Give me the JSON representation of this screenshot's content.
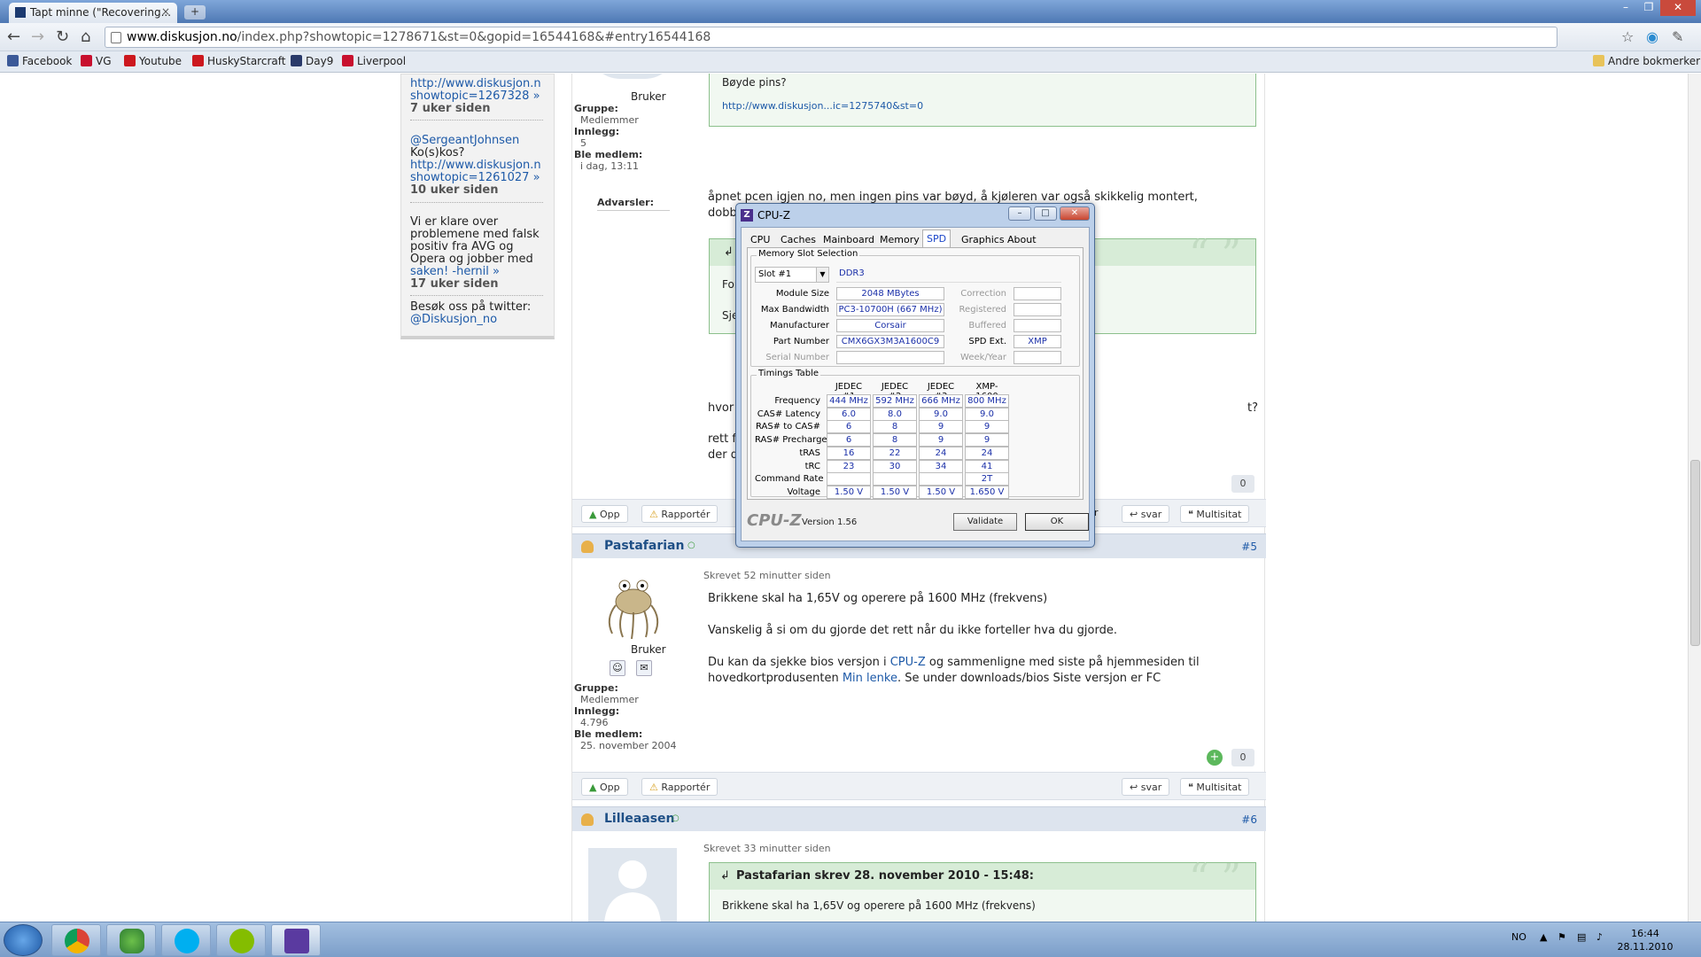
{
  "browser": {
    "tab_title": "Tapt minne (\"Recovering...",
    "tab_close": "×",
    "new_tab": "+",
    "url_host": "www.diskusjon.no",
    "url_path": "/index.php?showtopic=1278671&st=0&gopid=16544168&#entry16544168",
    "other_bookmarks": "Andre bokmerker",
    "bookmarks": [
      "Facebook",
      "VG",
      "Youtube",
      "HuskyStarcraft",
      "Day9",
      "Liverpool"
    ]
  },
  "sidebar": {
    "entry1_link1": "http://www.diskusjon.n",
    "entry1_link2": "showtopic=1267328 »",
    "entry1_time": "7 uker siden",
    "entry2_user": "@SergeantJohnsen",
    "entry2_text": "Ko(s)kos?",
    "entry2_link1": "http://www.diskusjon.n",
    "entry2_link2": "showtopic=1261027 »",
    "entry2_time": "10 uker siden",
    "entry3_l1": "Vi er klare over",
    "entry3_l2": "problemene med falsk",
    "entry3_l3": "positiv fra AVG og",
    "entry3_l4": "Opera og jobber med",
    "entry3_l5": "saken! -hernil »",
    "entry3_time": "17 uker siden",
    "twitter_l1": "Besøk oss på twitter:",
    "twitter_l2": "@Diskusjon_no"
  },
  "post4": {
    "role": "Bruker",
    "group_label": "Gruppe:",
    "group": "Medlemmer",
    "posts_label": "Innlegg:",
    "posts": "5",
    "member_label": "Ble medlem:",
    "member": "i dag, 13:11",
    "warn_label": "Advarsler:",
    "quote_top": "Bøyde pins?",
    "quote_link": "http://www.diskusjon...ic=1275740&st=0",
    "line1": "åpnet pcen igjen no, men ingen pins var bøyd, å kjøleren var også skikkelig montert,",
    "line2": "dobb",
    "q2_a": "For",
    "q2_b": "Sje",
    "line3": "hvor",
    "line3_end": "t?",
    "line4": "rett f",
    "line5": "der d",
    "votes": "0",
    "btn_top": "Opp",
    "btn_report": "Rapportér",
    "btn_r": "r",
    "btn_reply": "svar",
    "btn_multi": "Multisitat"
  },
  "post5": {
    "author": "Pastafarian",
    "number": "#5",
    "written": "Skrevet 52 minutter siden",
    "text1": "Brikkene skal ha 1,65V og operere på 1600 MHz (frekvens)",
    "text2": "Vanskelig å si om du gjorde det rett når du ikke forteller hva du gjorde.",
    "text3a": "Du kan da sjekke bios versjon i ",
    "text3_link": "CPU-Z",
    "text3b": " og sammenligne med siste på hjemmesiden til",
    "text4a": "hovedkortprodusenten ",
    "text4_link": "Min lenke",
    "text4b": ". Se under downloads/bios Siste versjon er FC",
    "role": "Bruker",
    "group_label": "Gruppe:",
    "group": "Medlemmer",
    "posts_label": "Innlegg:",
    "posts": "4.796",
    "member_label": "Ble medlem:",
    "member": "25. november 2004",
    "votes": "0",
    "btn_top": "Opp",
    "btn_report": "Rapportér",
    "btn_reply": "svar",
    "btn_multi": "Multisitat"
  },
  "post6": {
    "author": "Lilleaasen",
    "number": "#6",
    "written": "Skrevet 33 minutter siden",
    "quote_head": "Pastafarian skrev 28. november 2010 - 15:48:",
    "quote_text": "Brikkene skal ha 1,65V og operere på 1600 MHz (frekvens)"
  },
  "cpuz": {
    "title": "CPU-Z",
    "logo": "Z",
    "tabs": [
      "CPU",
      "Caches",
      "Mainboard",
      "Memory",
      "SPD",
      "Graphics",
      "About"
    ],
    "slot_group": "Memory Slot Selection",
    "slot": "Slot #1",
    "mem_type": "DDR3",
    "labels": {
      "module_size": "Module Size",
      "max_bandwidth": "Max Bandwidth",
      "manufacturer": "Manufacturer",
      "part_number": "Part Number",
      "serial_number": "Serial Number",
      "correction": "Correction",
      "registered": "Registered",
      "buffered": "Buffered",
      "spd_ext": "SPD Ext.",
      "week_year": "Week/Year"
    },
    "values": {
      "module_size": "2048 MBytes",
      "max_bandwidth": "PC3-10700H (667 MHz)",
      "manufacturer": "Corsair",
      "part_number": "CMX6GX3M3A1600C9",
      "spd_ext": "XMP"
    },
    "timings_group": "Timings Table",
    "timing_cols": [
      "JEDEC #1",
      "JEDEC #2",
      "JEDEC #3",
      "XMP-1600"
    ],
    "timing_rows": [
      {
        "label": "Frequency",
        "v": [
          "444 MHz",
          "592 MHz",
          "666 MHz",
          "800 MHz"
        ]
      },
      {
        "label": "CAS# Latency",
        "v": [
          "6.0",
          "8.0",
          "9.0",
          "9.0"
        ]
      },
      {
        "label": "RAS# to CAS#",
        "v": [
          "6",
          "8",
          "9",
          "9"
        ]
      },
      {
        "label": "RAS# Precharge",
        "v": [
          "6",
          "8",
          "9",
          "9"
        ]
      },
      {
        "label": "tRAS",
        "v": [
          "16",
          "22",
          "24",
          "24"
        ]
      },
      {
        "label": "tRC",
        "v": [
          "23",
          "30",
          "34",
          "41"
        ]
      },
      {
        "label": "Command Rate",
        "v": [
          "",
          "",
          "",
          "2T"
        ]
      },
      {
        "label": "Voltage",
        "v": [
          "1.50 V",
          "1.50 V",
          "1.50 V",
          "1.650 V"
        ]
      }
    ],
    "brand": "CPU-Z",
    "version": "Version 1.56",
    "validate": "Validate",
    "ok": "OK"
  },
  "taskbar": {
    "lang": "NO",
    "time": "16:44",
    "date": "28.11.2010"
  },
  "colors": {
    "link": "#1e5aa8",
    "quote_border": "#8cc08c",
    "cpuz_value": "#1a2fa8"
  }
}
